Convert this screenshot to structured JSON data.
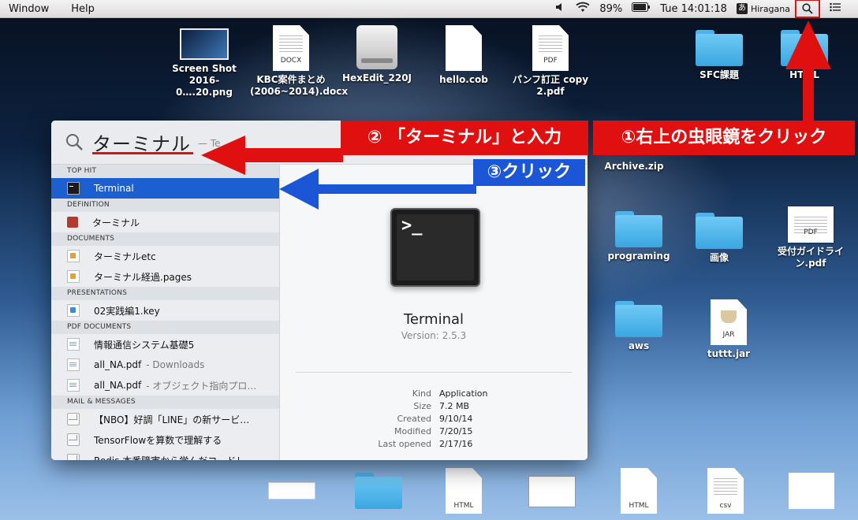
{
  "menubar": {
    "items": [
      "Window",
      "Help"
    ],
    "battery": "89%",
    "clock": "Tue 14:01:18",
    "input_badge": "あ",
    "input_method": "Hiragana"
  },
  "desktop": {
    "icons": [
      {
        "label": "Screen Shot 2016-0….20.png"
      },
      {
        "label": "KBC案件まとめ (2006~2014).docx",
        "tag": "DOCX"
      },
      {
        "label": "HexEdit_220J"
      },
      {
        "label": "hello.cob"
      },
      {
        "label": "パンフ訂正 copy 2.pdf",
        "tag": "PDF"
      },
      {
        "label": "SFC課題"
      },
      {
        "label": "HTML"
      },
      {
        "label": "Archive.zip"
      },
      {
        "label": "programing"
      },
      {
        "label": "画像"
      },
      {
        "label": "受付ガイドライン.pdf",
        "tag": "PDF"
      },
      {
        "label": "aws"
      },
      {
        "label": "tuttt.jar",
        "tag": "JAR"
      }
    ],
    "bottom_tags": [
      "HTML",
      "HTML",
      "csv"
    ]
  },
  "annotations": {
    "step1": "①右上の虫眼鏡をクリック",
    "step2": "② 「ターミナル」と入力",
    "step3": "③クリック"
  },
  "spotlight": {
    "query": "ターミナル",
    "suffix": "— Te",
    "sections": {
      "top_hit": "TOP HIT",
      "definition": "DEFINITION",
      "documents": "DOCUMENTS",
      "presentations": "PRESENTATIONS",
      "pdf_documents": "PDF DOCUMENTS",
      "mail": "MAIL & MESSAGES"
    },
    "results": {
      "top_hit": "Terminal",
      "definition": "ターミナル",
      "doc1": "ターミナルetc",
      "doc2": "ターミナル経過.pages",
      "pres1": "02実践編1.key",
      "pdf1": "情報通信システム基礎5",
      "pdf2_name": "all_NA.pdf",
      "pdf2_sub": "- Downloads",
      "pdf3_name": "all_NA.pdf",
      "pdf3_sub": "- オブジェクト指向プロ…",
      "mail1": "【NBO】好調「LINE」の新サービ…",
      "mail2": "TensorFlowを算数で理解する",
      "mail3": "Redis 本番障害から学んだコードレ…"
    },
    "preview": {
      "name": "Terminal",
      "version": "Version: 2.5.3",
      "prompt": ">_",
      "meta": [
        {
          "k": "Kind",
          "v": "Application"
        },
        {
          "k": "Size",
          "v": "7.2 MB"
        },
        {
          "k": "Created",
          "v": "9/10/14"
        },
        {
          "k": "Modified",
          "v": "7/20/15"
        },
        {
          "k": "Last opened",
          "v": "2/17/16"
        }
      ]
    }
  },
  "colors": {
    "annotation_red": "#e01010",
    "annotation_blue": "#1a56d6",
    "selection": "#1b5fd1"
  }
}
